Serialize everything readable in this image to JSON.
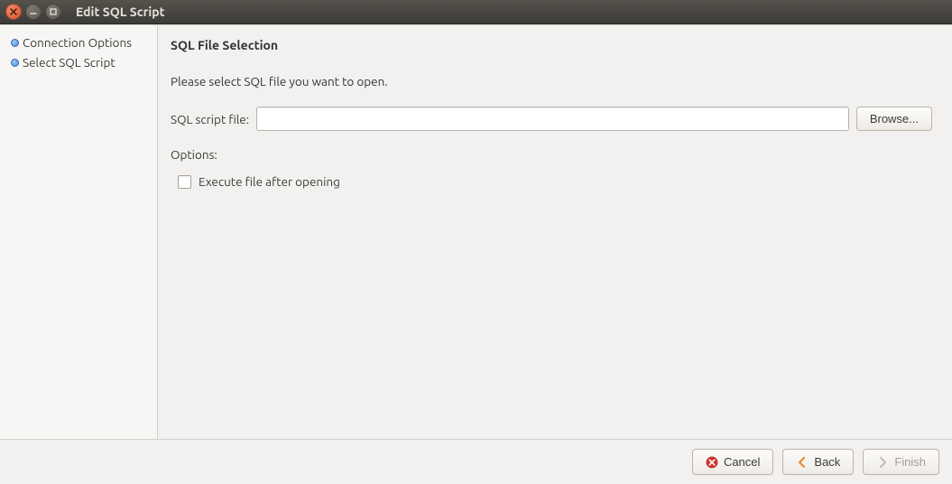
{
  "window": {
    "title": "Edit SQL Script"
  },
  "sidebar": {
    "items": [
      {
        "label": "Connection Options"
      },
      {
        "label": "Select SQL Script"
      }
    ]
  },
  "main": {
    "heading": "SQL File Selection",
    "instruction": "Please select SQL file you want to open.",
    "file_label": "SQL script file:",
    "file_value": "",
    "browse_label": "Browse...",
    "options_label": "Options:",
    "execute_checkbox_label": "Execute file after opening",
    "execute_checked": false
  },
  "footer": {
    "cancel": "Cancel",
    "back": "Back",
    "finish": "Finish"
  }
}
